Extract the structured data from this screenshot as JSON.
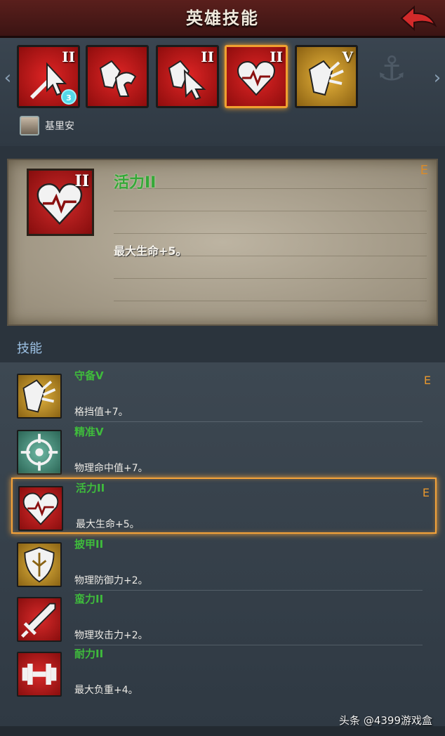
{
  "header": {
    "title": "英雄技能"
  },
  "strip": {
    "tiles": [
      {
        "level": "II",
        "color": "red",
        "icon": "sword-cursor-icon",
        "badge": "3"
      },
      {
        "level": "",
        "color": "red",
        "icon": "shield-beast-icon",
        "badge": ""
      },
      {
        "level": "II",
        "color": "red",
        "icon": "shield-cursor-icon",
        "badge": ""
      },
      {
        "level": "II",
        "color": "red",
        "icon": "heart-icon",
        "badge": "",
        "selected": true
      },
      {
        "level": "V",
        "color": "gold",
        "icon": "shield-break-icon",
        "badge": ""
      }
    ],
    "hero_name": "基里安"
  },
  "detail": {
    "level": "II",
    "name": "活力II",
    "rank": "E",
    "desc": "最大生命+5。"
  },
  "skills_title": "技能",
  "skills": [
    {
      "name": "守备V",
      "desc": "格挡值+7。",
      "rank": "E",
      "color": "gold",
      "icon": "shield-break-icon"
    },
    {
      "name": "精准V",
      "desc": "物理命中值+7。",
      "rank": "",
      "color": "teal",
      "icon": "crosshair-icon"
    },
    {
      "name": "活力II",
      "desc": "最大生命+5。",
      "rank": "E",
      "color": "red",
      "icon": "heart-icon",
      "selected": true
    },
    {
      "name": "披甲II",
      "desc": "物理防御力+2。",
      "rank": "",
      "color": "gold",
      "icon": "shield-icon"
    },
    {
      "name": "蛮力II",
      "desc": "物理攻击力+2。",
      "rank": "",
      "color": "red",
      "icon": "sword-icon"
    },
    {
      "name": "耐力II",
      "desc": "最大负重+4。",
      "rank": "",
      "color": "red",
      "icon": "dumbbell-icon"
    }
  ],
  "watermark": "头条 @4399游戏盒"
}
